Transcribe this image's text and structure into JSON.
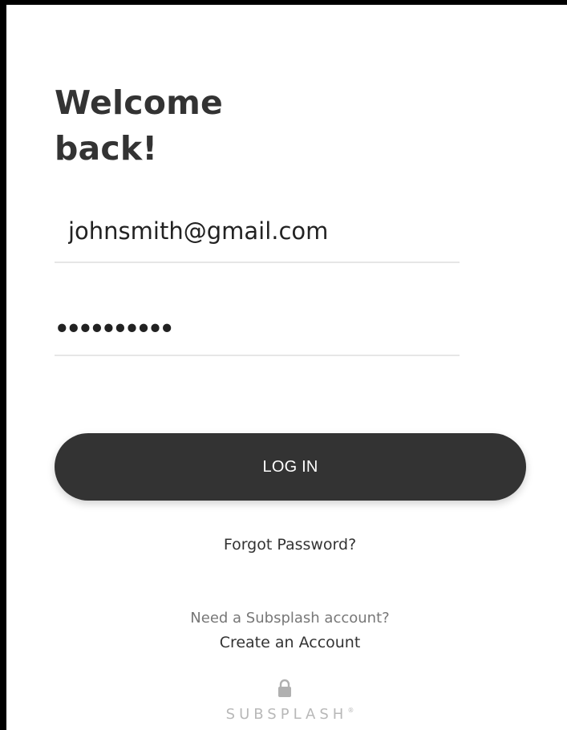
{
  "login": {
    "title_line1": "Welcome",
    "title_line2": "back!",
    "email_value": "johnsmith@gmail.com",
    "password_dots": "••••••••••",
    "login_label": "LOG IN",
    "forgot_label": "Forgot Password?",
    "need_account_text": "Need a Subsplash account?",
    "create_account_label": "Create an Account"
  },
  "footer": {
    "brand_text": "SUBSPLASH",
    "brand_mark": "®",
    "icon": "lock-icon"
  },
  "colors": {
    "button": "#333333",
    "text": "#333333",
    "muted": "#777777",
    "brand": "#b8b8b8"
  }
}
